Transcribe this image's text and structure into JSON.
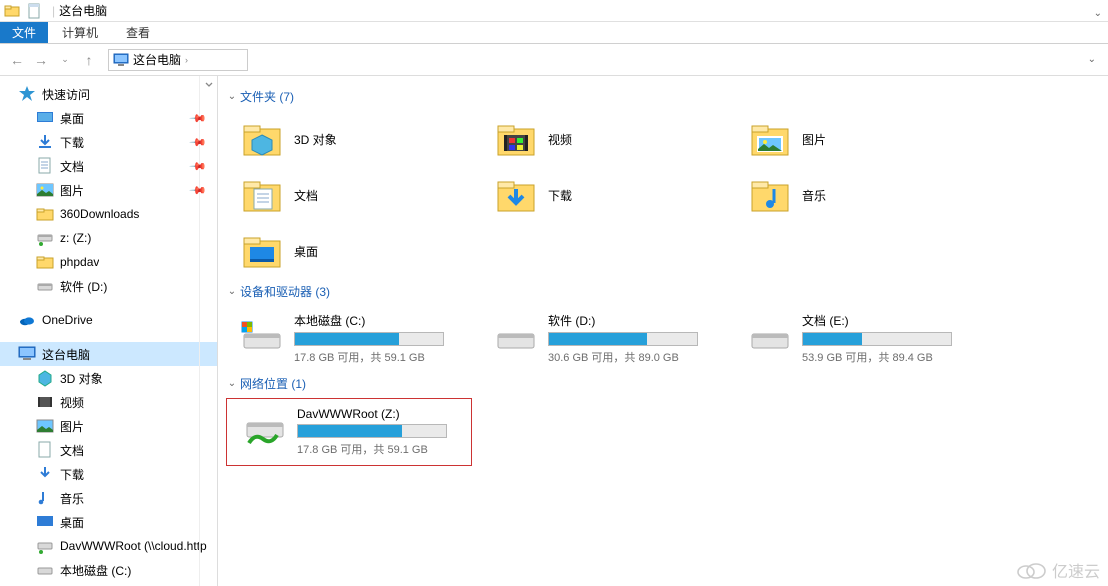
{
  "title": "这台电脑",
  "menu": {
    "file": "文件",
    "computer": "计算机",
    "view": "查看"
  },
  "breadcrumb": {
    "root": "这台电脑"
  },
  "sidebar": {
    "quick_access": "快速访问",
    "items_pinned": [
      {
        "label": "桌面"
      },
      {
        "label": "下载"
      },
      {
        "label": "文档"
      },
      {
        "label": "图片"
      },
      {
        "label": "360Downloads"
      },
      {
        "label": "z: (Z:)"
      },
      {
        "label": "phpdav"
      },
      {
        "label": "软件 (D:)"
      }
    ],
    "onedrive": "OneDrive",
    "this_pc": "这台电脑",
    "pc_children": [
      {
        "label": "3D 对象"
      },
      {
        "label": "视频"
      },
      {
        "label": "图片"
      },
      {
        "label": "文档"
      },
      {
        "label": "下载"
      },
      {
        "label": "音乐"
      },
      {
        "label": "桌面"
      },
      {
        "label": "DavWWWRoot (\\\\cloud.http"
      },
      {
        "label": "本地磁盘 (C:)"
      }
    ]
  },
  "groups": {
    "folders_header": "文件夹 (7)",
    "drives_header": "设备和驱动器 (3)",
    "network_header": "网络位置 (1)"
  },
  "folders": [
    {
      "label": "3D 对象"
    },
    {
      "label": "视频"
    },
    {
      "label": "图片"
    },
    {
      "label": "文档"
    },
    {
      "label": "下载"
    },
    {
      "label": "音乐"
    },
    {
      "label": "桌面"
    }
  ],
  "drives": [
    {
      "label": "本地磁盘 (C:)",
      "status": "17.8 GB 可用，共 59.1 GB",
      "fill": 70
    },
    {
      "label": "软件 (D:)",
      "status": "30.6 GB 可用，共 89.0 GB",
      "fill": 66
    },
    {
      "label": "文档 (E:)",
      "status": "53.9 GB 可用，共 89.4 GB",
      "fill": 40
    }
  ],
  "network": [
    {
      "label": "DavWWWRoot  (Z:)",
      "status": "17.8 GB 可用，共 59.1 GB",
      "fill": 70
    }
  ],
  "watermark": "亿速云"
}
